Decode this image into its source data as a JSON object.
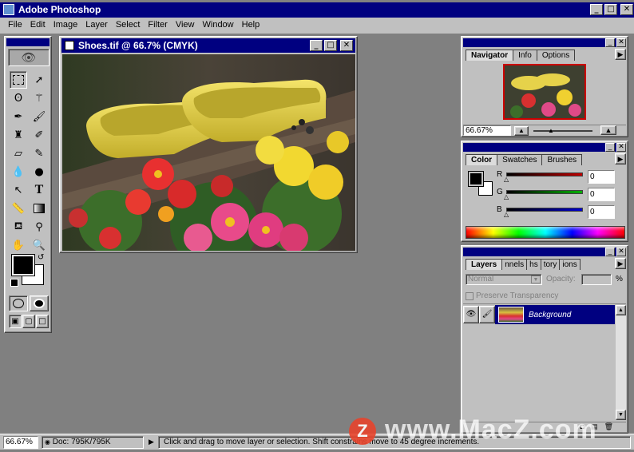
{
  "app": {
    "title": "Adobe Photoshop"
  },
  "menu": [
    "File",
    "Edit",
    "Image",
    "Layer",
    "Select",
    "Filter",
    "View",
    "Window",
    "Help"
  ],
  "document": {
    "title": "Shoes.tif @ 66.7% (CMYK)"
  },
  "navigator": {
    "tabs": [
      "Navigator",
      "Info",
      "Options"
    ],
    "zoom": "66.67%"
  },
  "color": {
    "tabs": [
      "Color",
      "Swatches",
      "Brushes"
    ],
    "channels": [
      {
        "label": "R",
        "value": "0",
        "color": "#c00000"
      },
      {
        "label": "G",
        "value": "0",
        "color": "#00a000"
      },
      {
        "label": "B",
        "value": "0",
        "color": "#0000c0"
      }
    ]
  },
  "layers": {
    "tabs": [
      "Layers",
      "nnels",
      "hs",
      "tory",
      "ions"
    ],
    "blend_mode": "Normal",
    "opacity_label": "Opacity:",
    "opacity_unit": "%",
    "preserve_label": "Preserve Transparency",
    "layer_name": "Background"
  },
  "status": {
    "zoom": "66.67%",
    "doc": "Doc: 795K/795K",
    "hint": "Click and drag to move layer or selection. Shift constrains move to 45 degree increments."
  },
  "watermark": {
    "text": "www.MacZ.com",
    "logo_letter": "Z"
  },
  "colors": {
    "titlebar": "#000080",
    "desktop": "#808080",
    "chrome": "#c0c0c0"
  }
}
